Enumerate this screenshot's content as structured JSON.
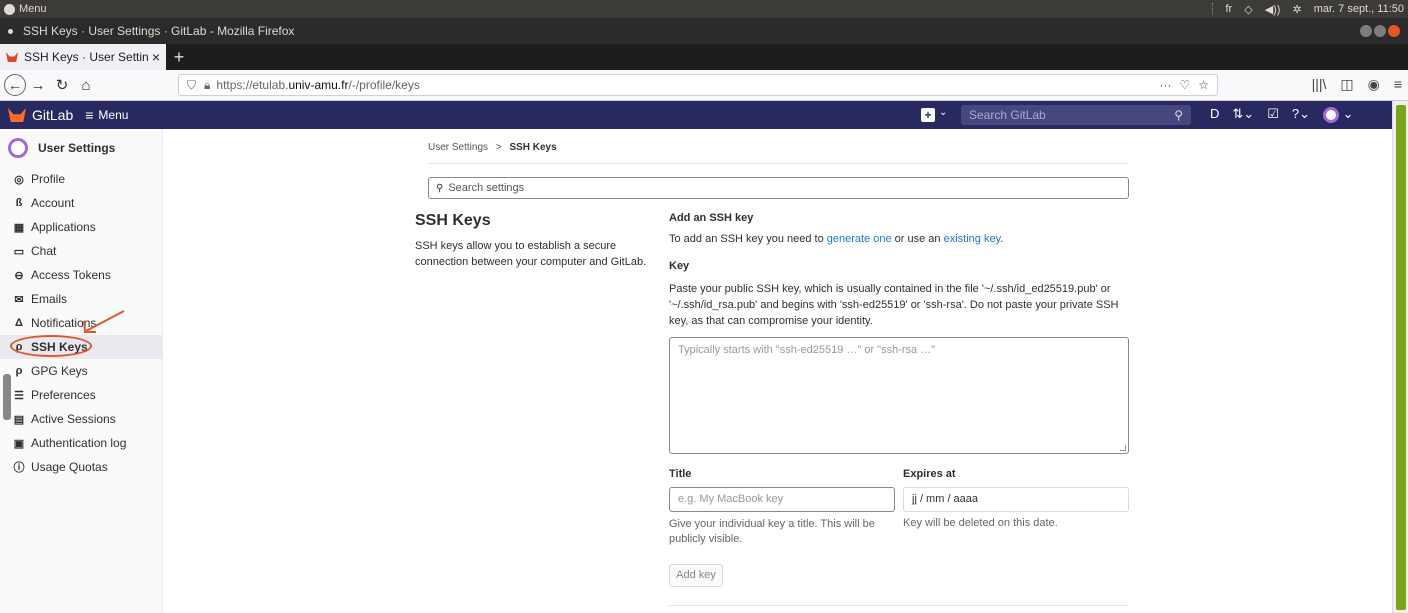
{
  "os": {
    "menu_label": "Menu",
    "keyboard": "fr",
    "datetime": "mar. 7 sept., 11:50"
  },
  "window": {
    "title": "SSH Keys · User Settings · GitLab - Mozilla Firefox"
  },
  "browser": {
    "tab_title": "SSH Keys · User Settings",
    "url_prefix": "https://etulab.",
    "url_domain": "univ-amu.fr",
    "url_path": "/-/profile/keys",
    "url_more": "···"
  },
  "gitlab": {
    "brand": "GitLab",
    "menu_label": "Menu",
    "search_placeholder": "Search GitLab"
  },
  "sidebar": {
    "heading": "User Settings",
    "items": [
      {
        "label": "Profile",
        "icon": "profile-icon"
      },
      {
        "label": "Account",
        "icon": "account-icon"
      },
      {
        "label": "Applications",
        "icon": "applications-icon"
      },
      {
        "label": "Chat",
        "icon": "chat-icon"
      },
      {
        "label": "Access Tokens",
        "icon": "token-icon"
      },
      {
        "label": "Emails",
        "icon": "mail-icon"
      },
      {
        "label": "Notifications",
        "icon": "bell-icon"
      },
      {
        "label": "SSH Keys",
        "icon": "key-icon"
      },
      {
        "label": "GPG Keys",
        "icon": "key-icon"
      },
      {
        "label": "Preferences",
        "icon": "preferences-icon"
      },
      {
        "label": "Active Sessions",
        "icon": "monitor-icon"
      },
      {
        "label": "Authentication log",
        "icon": "log-icon"
      },
      {
        "label": "Usage Quotas",
        "icon": "quota-icon"
      }
    ]
  },
  "main": {
    "breadcrumb_parent": "User Settings",
    "breadcrumb_sep": ">",
    "breadcrumb_current": "SSH Keys",
    "search_placeholder": "Search settings",
    "section_title": "SSH Keys",
    "section_desc": "SSH keys allow you to establish a secure connection between your computer and GitLab.",
    "add_title": "Add an SSH key",
    "add_desc_1": "To add an SSH key you need to ",
    "add_link_1": "generate one",
    "add_desc_2": " or use an ",
    "add_link_2": "existing key",
    "add_desc_3": ".",
    "key_label": "Key",
    "key_help": "Paste your public SSH key, which is usually contained in the file '~/.ssh/id_ed25519.pub' or '~/.ssh/id_rsa.pub' and begins with 'ssh-ed25519' or 'ssh-rsa'. Do not paste your private SSH key, as that can compromise your identity.",
    "key_placeholder": "Typically starts with \"ssh-ed25519 …\" or \"ssh-rsa …\"",
    "title_label": "Title",
    "title_placeholder": "e.g. My MacBook key",
    "title_help": "Give your individual key a title. This will be publicly visible.",
    "expires_label": "Expires at",
    "expires_value": "jj / mm / aaaa",
    "expires_help": "Key will be deleted on this date.",
    "add_button": "Add key"
  },
  "colors": {
    "gitlab_header": "#292961",
    "annotation": "#e0552b",
    "link": "#1f78d1"
  }
}
